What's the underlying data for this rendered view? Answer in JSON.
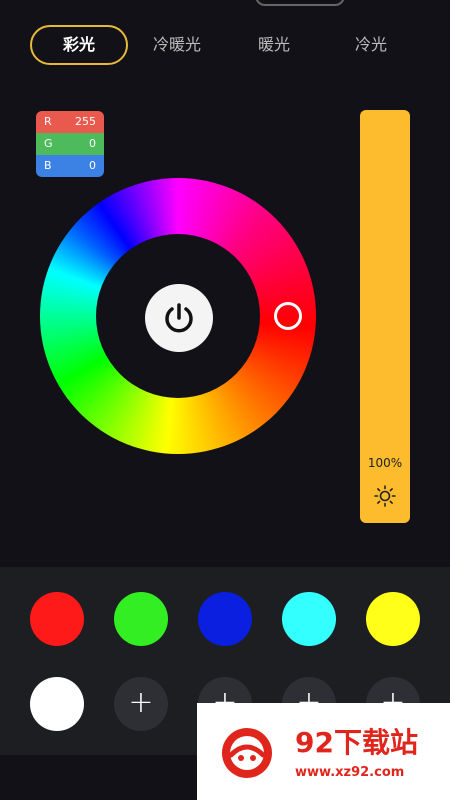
{
  "tabs": [
    {
      "label": "彩光",
      "active": true
    },
    {
      "label": "冷暖光",
      "active": false
    },
    {
      "label": "暖光",
      "active": false
    },
    {
      "label": "冷光",
      "active": false
    }
  ],
  "rgb": {
    "r_label": "R",
    "r_value": "255",
    "g_label": "G",
    "g_value": "0",
    "b_label": "B",
    "b_value": "0"
  },
  "brightness": {
    "value_text": "100%",
    "icon": "sun-icon",
    "color": "#fcbc2e"
  },
  "power_icon": "power-icon",
  "presets": {
    "colors": [
      "#ff1a1a",
      "#33ee22",
      "#0a1fe0",
      "#33ffff",
      "#ffff1a",
      "#ffffff"
    ],
    "add_label": "+"
  },
  "watermark": {
    "title": "92下载站",
    "url": "www.xz92.com"
  }
}
